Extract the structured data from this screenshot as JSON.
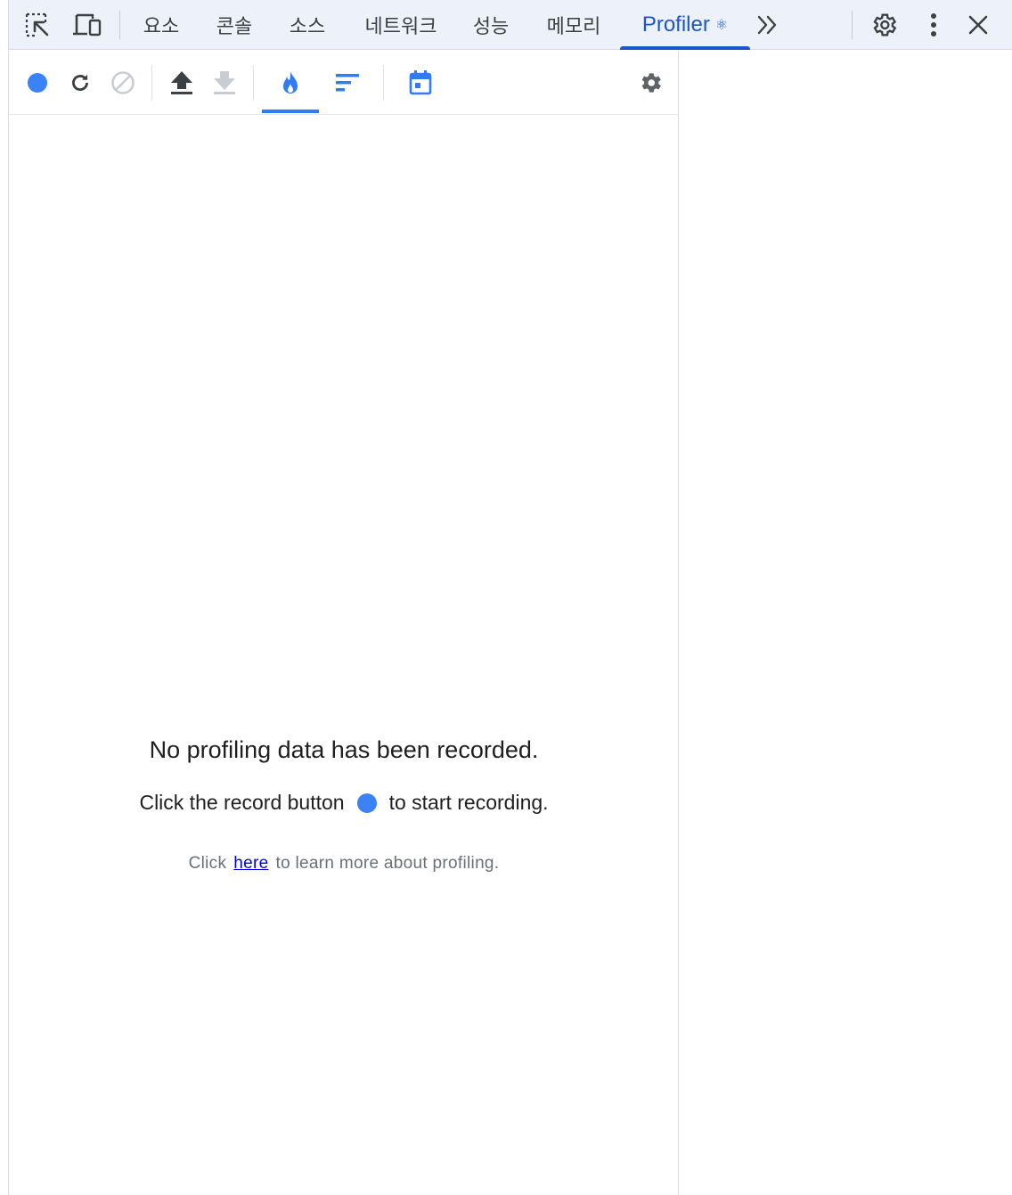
{
  "topbar": {
    "tabs": [
      {
        "label": "요소"
      },
      {
        "label": "콘솔"
      },
      {
        "label": "소스"
      },
      {
        "label": "네트워크"
      },
      {
        "label": "성능"
      },
      {
        "label": "메모리"
      },
      {
        "label": "Profiler",
        "active": true
      }
    ],
    "profiler_badge": "⚛",
    "more_tabs_glyph": "»",
    "icons": [
      "inspect-element-icon",
      "device-toolbar-icon",
      "more-tabs-icon",
      "settings-gear-icon",
      "kebab-menu-icon",
      "close-icon"
    ]
  },
  "profiler": {
    "toolbar_icons": [
      "record-icon",
      "reload-and-profile-icon",
      "clear-icon",
      "upload-icon",
      "download-icon",
      "flamegraph-icon",
      "ranked-chart-icon",
      "timeline-calendar-icon",
      "profiler-settings-icon"
    ],
    "empty_state": {
      "title": "No profiling data has been recorded.",
      "line2_before": "Click the record button",
      "line2_after": "to start recording.",
      "line3_before": "Click",
      "line3_link": "here",
      "line3_after": "to learn more about profiling."
    }
  },
  "colors": {
    "accent": "#1a56c9",
    "record_blue": "#3b82f6",
    "tab_bar_bg": "#edf2fa",
    "link": "#0000ee"
  }
}
